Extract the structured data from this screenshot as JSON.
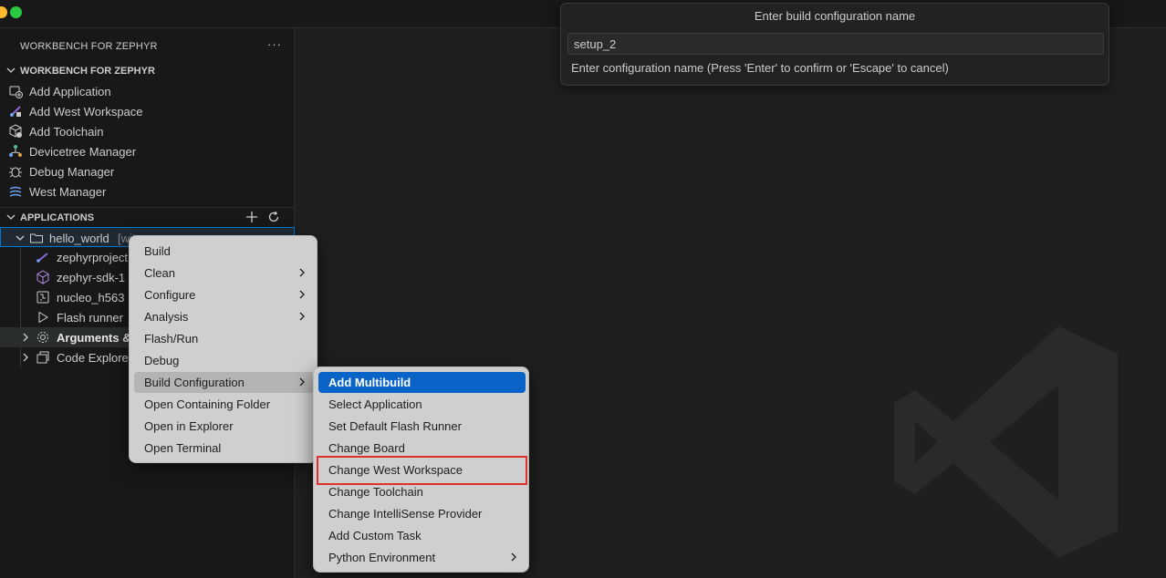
{
  "quick_input": {
    "title": "Enter build configuration name",
    "value": "setup_2",
    "message": "Enter configuration name (Press 'Enter' to confirm or 'Escape' to cancel)"
  },
  "sidebar": {
    "title": "WORKBENCH FOR ZEPHYR",
    "more": "···",
    "workbench_section": {
      "title": "WORKBENCH FOR ZEPHYR",
      "items": [
        {
          "label": "Add Application",
          "icon": "add-application-icon"
        },
        {
          "label": "Add West Workspace",
          "icon": "west-workspace-icon"
        },
        {
          "label": "Add Toolchain",
          "icon": "toolchain-icon"
        },
        {
          "label": "Devicetree Manager",
          "icon": "devicetree-icon"
        },
        {
          "label": "Debug Manager",
          "icon": "debug-icon"
        },
        {
          "label": "West Manager",
          "icon": "west-manager-icon"
        }
      ]
    },
    "applications_section": {
      "title": "APPLICATIONS",
      "project": {
        "label": "hello_world",
        "suffix": "[wit"
      },
      "children": [
        {
          "label": "zephyrproject",
          "icon": "west-workspace-icon"
        },
        {
          "label": "zephyr-sdk-1",
          "icon": "sdk-cube-icon"
        },
        {
          "label": "nucleo_h563",
          "icon": "board-icon"
        },
        {
          "label": "Flash runner",
          "icon": "play-icon"
        },
        {
          "label": "Arguments &",
          "icon": "gear-icon"
        },
        {
          "label": "Code Explore",
          "icon": "explorer-icon"
        }
      ]
    }
  },
  "context_menu": {
    "items": [
      {
        "label": "Build",
        "submenu": false
      },
      {
        "label": "Clean",
        "submenu": true
      },
      {
        "label": "Configure",
        "submenu": true
      },
      {
        "label": "Analysis",
        "submenu": true
      },
      {
        "label": "Flash/Run",
        "submenu": false
      },
      {
        "label": "Debug",
        "submenu": false
      },
      {
        "label": "Build Configuration",
        "submenu": true
      },
      {
        "label": "Open Containing Folder",
        "submenu": false
      },
      {
        "label": "Open in Explorer",
        "submenu": false
      },
      {
        "label": "Open Terminal",
        "submenu": false
      }
    ]
  },
  "submenu": {
    "items": [
      {
        "label": "Add Multibuild",
        "submenu": false
      },
      {
        "label": "Select Application",
        "submenu": false
      },
      {
        "label": "Set Default Flash Runner",
        "submenu": false
      },
      {
        "label": "Change Board",
        "submenu": false
      },
      {
        "label": "Change West Workspace",
        "submenu": false
      },
      {
        "label": "Change Toolchain",
        "submenu": false
      },
      {
        "label": "Change IntelliSense Provider",
        "submenu": false
      },
      {
        "label": "Add Custom Task",
        "submenu": false
      },
      {
        "label": "Python Environment",
        "submenu": true
      }
    ]
  },
  "colors": {
    "accent": "#0a64c8",
    "highlight_box": "#e0302a"
  }
}
